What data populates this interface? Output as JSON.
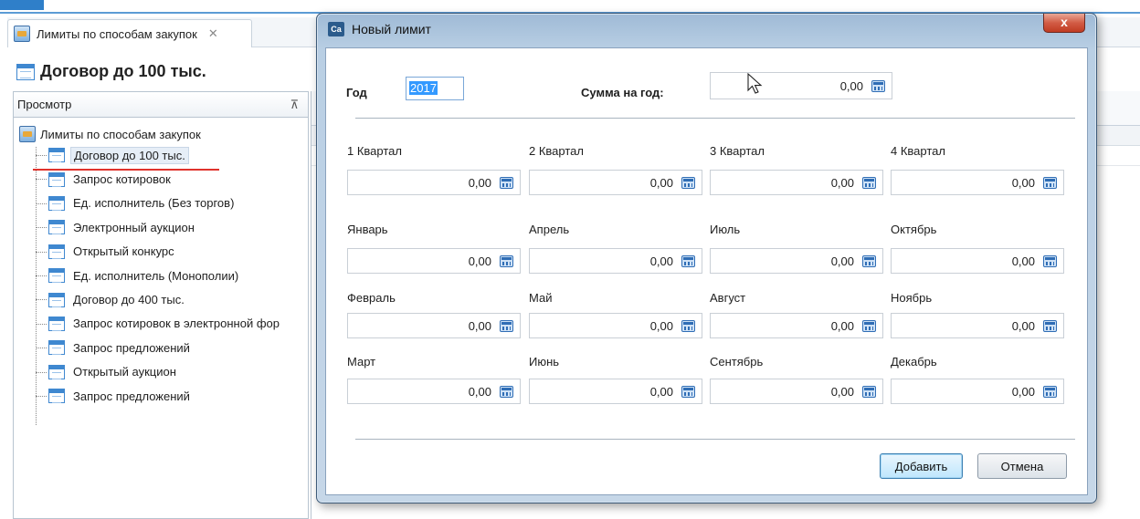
{
  "app": {
    "tab_label": "Лимиты по способам закупок",
    "tab_close": "✕",
    "page_title": "Договор до 100 тыс.",
    "panel_header": "Просмотр",
    "pin": "⊼",
    "tree": {
      "root": "Лимиты по способам закупок",
      "items": [
        "Договор до 100 тыс.",
        "Запрос котировок",
        "Ед. исполнитель (Без торгов)",
        "Электронный аукцион",
        "Открытый конкурс",
        "Ед. исполнитель (Монополии)",
        "Договор до 400 тыс.",
        "Запрос котировок в электронной фор",
        "Запрос предложений",
        "Открытый аукцион",
        "Запрос предложений"
      ],
      "selected_index": 0
    }
  },
  "dialog": {
    "title": "Новый лимит",
    "icon_text": "Ca",
    "close": "x",
    "year_label": "Год",
    "year_value": "2017",
    "sum_label": "Сумма на год:",
    "sum_value": "0,00",
    "quarters": [
      {
        "label": "1 Квартал",
        "value": "0,00"
      },
      {
        "label": "2 Квартал",
        "value": "0,00"
      },
      {
        "label": "3 Квартал",
        "value": "0,00"
      },
      {
        "label": "4 Квартал",
        "value": "0,00"
      }
    ],
    "months": [
      {
        "label": "Январь",
        "value": "0,00"
      },
      {
        "label": "Апрель",
        "value": "0,00"
      },
      {
        "label": "Июль",
        "value": "0,00"
      },
      {
        "label": "Октябрь",
        "value": "0,00"
      },
      {
        "label": "Февраль",
        "value": "0,00"
      },
      {
        "label": "Май",
        "value": "0,00"
      },
      {
        "label": "Август",
        "value": "0,00"
      },
      {
        "label": "Ноябрь",
        "value": "0,00"
      },
      {
        "label": "Март",
        "value": "0,00"
      },
      {
        "label": "Июнь",
        "value": "0,00"
      },
      {
        "label": "Сентябрь",
        "value": "0,00"
      },
      {
        "label": "Декабрь",
        "value": "0,00"
      }
    ],
    "add_button": "Добавить",
    "cancel_button": "Отмена"
  }
}
